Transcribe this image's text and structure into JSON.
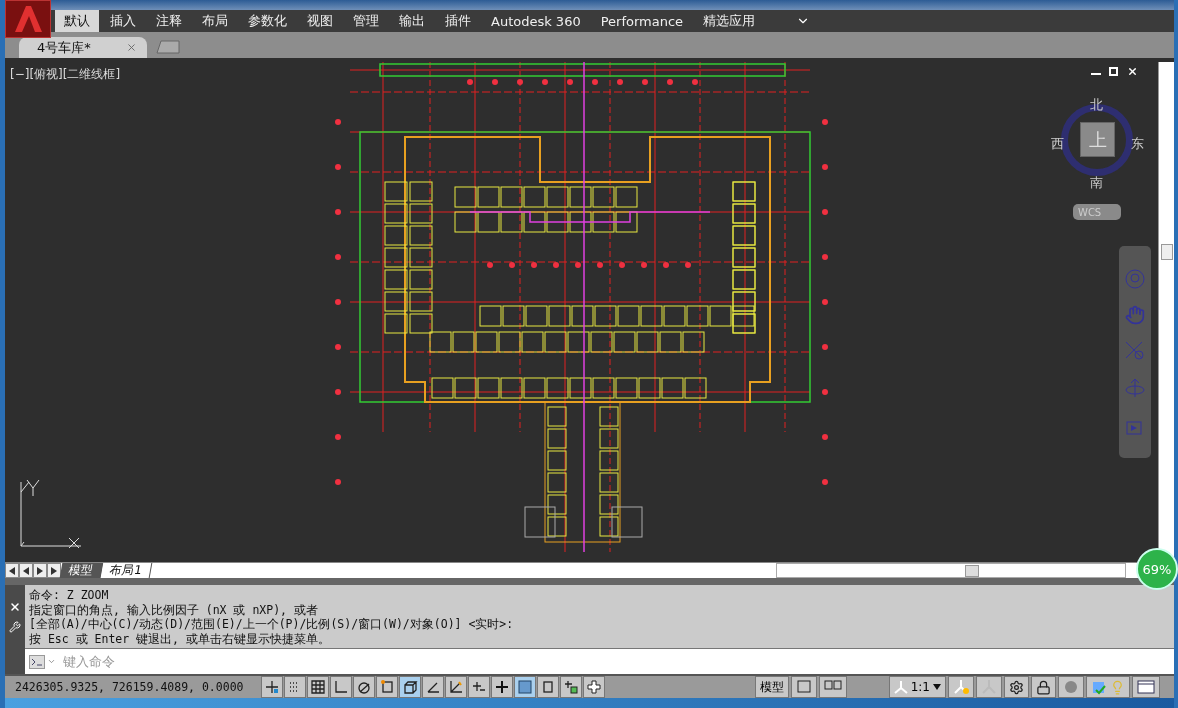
{
  "ribbon_tabs": [
    {
      "label": "默认",
      "selected": true
    },
    {
      "label": "插入",
      "selected": false
    },
    {
      "label": "注释",
      "selected": false
    },
    {
      "label": "布局",
      "selected": false
    },
    {
      "label": "参数化",
      "selected": false
    },
    {
      "label": "视图",
      "selected": false
    },
    {
      "label": "管理",
      "selected": false
    },
    {
      "label": "输出",
      "selected": false
    },
    {
      "label": "插件",
      "selected": false
    },
    {
      "label": "Autodesk 360",
      "selected": false
    },
    {
      "label": "Performance",
      "selected": false
    },
    {
      "label": "精选应用",
      "selected": false
    }
  ],
  "file_tabs": [
    {
      "label": "4号车库*",
      "selected": true
    }
  ],
  "viewport_label": "[−][俯视][二维线框]",
  "viewcube": {
    "north": "北",
    "south": "南",
    "east": "东",
    "west": "西",
    "face": "上",
    "ucs": "WCS"
  },
  "layout_tabs": [
    {
      "label": "模型",
      "selected": true
    },
    {
      "label": "布局1",
      "selected": false
    }
  ],
  "command_history": [
    "命令: Z ZOOM",
    "指定窗口的角点, 输入比例因子 (nX 或 nXP), 或者",
    "[全部(A)/中心(C)/动态(D)/范围(E)/上一个(P)/比例(S)/窗口(W)/对象(O)] <实时>:",
    "按 Esc 或 Enter 键退出, 或单击右键显示快捷菜单。"
  ],
  "command_input": {
    "placeholder": "键入命令"
  },
  "coordinates": "2426305.9325, 726159.4089, 0.0000",
  "status_toggles": [
    {
      "kind": "crosshair",
      "on": false
    },
    {
      "kind": "dots",
      "on": false
    },
    {
      "kind": "grid",
      "on": false
    },
    {
      "kind": "ortho",
      "on": false
    },
    {
      "kind": "polar",
      "on": false
    },
    {
      "kind": "snap",
      "on": false
    },
    {
      "kind": "cube",
      "on": true
    },
    {
      "kind": "angle",
      "on": false
    },
    {
      "kind": "ucs",
      "on": false
    },
    {
      "kind": "plus-t",
      "on": false
    },
    {
      "kind": "plus",
      "on": false
    },
    {
      "kind": "checker",
      "on": true
    },
    {
      "kind": "calc",
      "on": false
    },
    {
      "kind": "plus-box",
      "on": false
    },
    {
      "kind": "cross",
      "on": false
    }
  ],
  "status_model": "模型",
  "annotation_scale": "1:1",
  "zoom_badge": "69%"
}
